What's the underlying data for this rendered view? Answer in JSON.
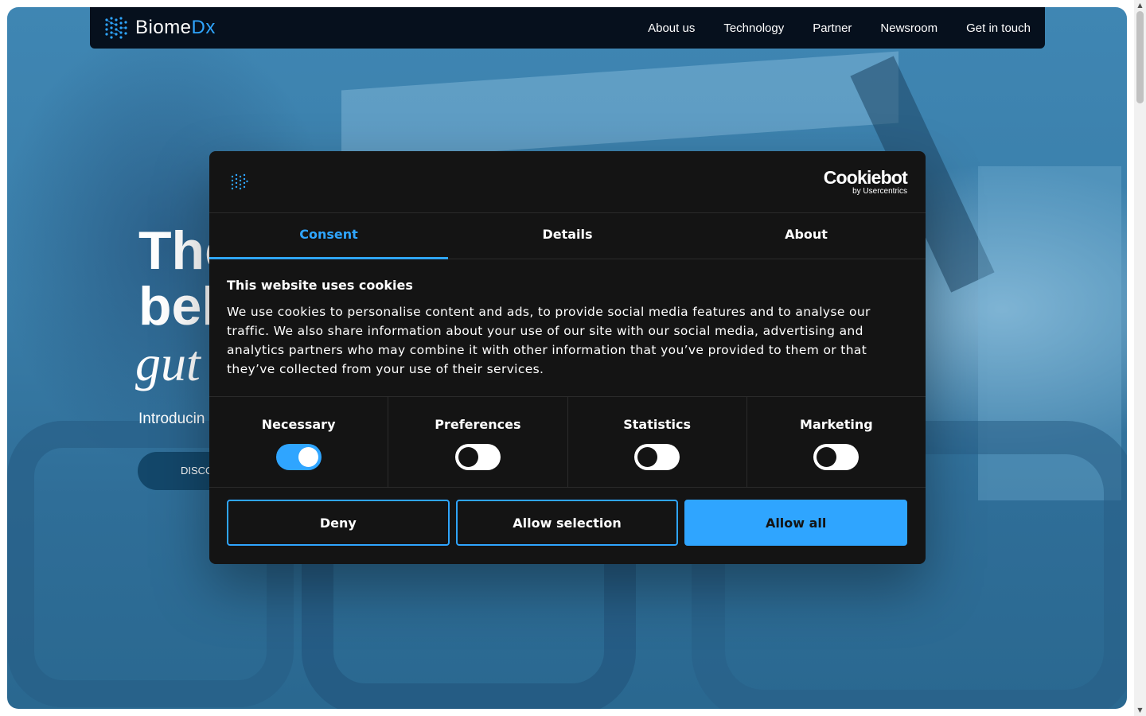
{
  "nav": {
    "logo": {
      "primary": "Biome",
      "accent": "Dx"
    },
    "links": [
      "About us",
      "Technology",
      "Partner",
      "Newsroom",
      "Get in touch"
    ]
  },
  "hero": {
    "title_line1": "The",
    "title_line2": "bel",
    "italic": "gut",
    "subtitle": "Introducin",
    "button_label": "DISCO"
  },
  "cookie_dialog": {
    "brand": {
      "name": "Cookiebot",
      "byline": "by Usercentrics"
    },
    "tabs": [
      {
        "label": "Consent",
        "active": true
      },
      {
        "label": "Details",
        "active": false
      },
      {
        "label": "About",
        "active": false
      }
    ],
    "heading": "This website uses cookies",
    "body": "We use cookies to personalise content and ads, to provide social media features and to analyse our traffic. We also share information about your use of our site with our social media, advertising and analytics partners who may combine it with other information that you’ve provided to them or that they’ve collected from your use of their services.",
    "categories": [
      {
        "label": "Necessary",
        "enabled": true
      },
      {
        "label": "Preferences",
        "enabled": false
      },
      {
        "label": "Statistics",
        "enabled": false
      },
      {
        "label": "Marketing",
        "enabled": false
      }
    ],
    "buttons": {
      "deny": "Deny",
      "allow_selection": "Allow selection",
      "allow_all": "Allow all"
    }
  },
  "colors": {
    "accent": "#2fa5ff",
    "dialog_bg": "#141414",
    "nav_bg": "#06101d",
    "hero_blue": "#3a7ea9"
  },
  "icons": {
    "logo": "biomedx-dot-logo-icon",
    "scroll_up": "arrow-up-icon",
    "scroll_down": "arrow-down-icon"
  }
}
